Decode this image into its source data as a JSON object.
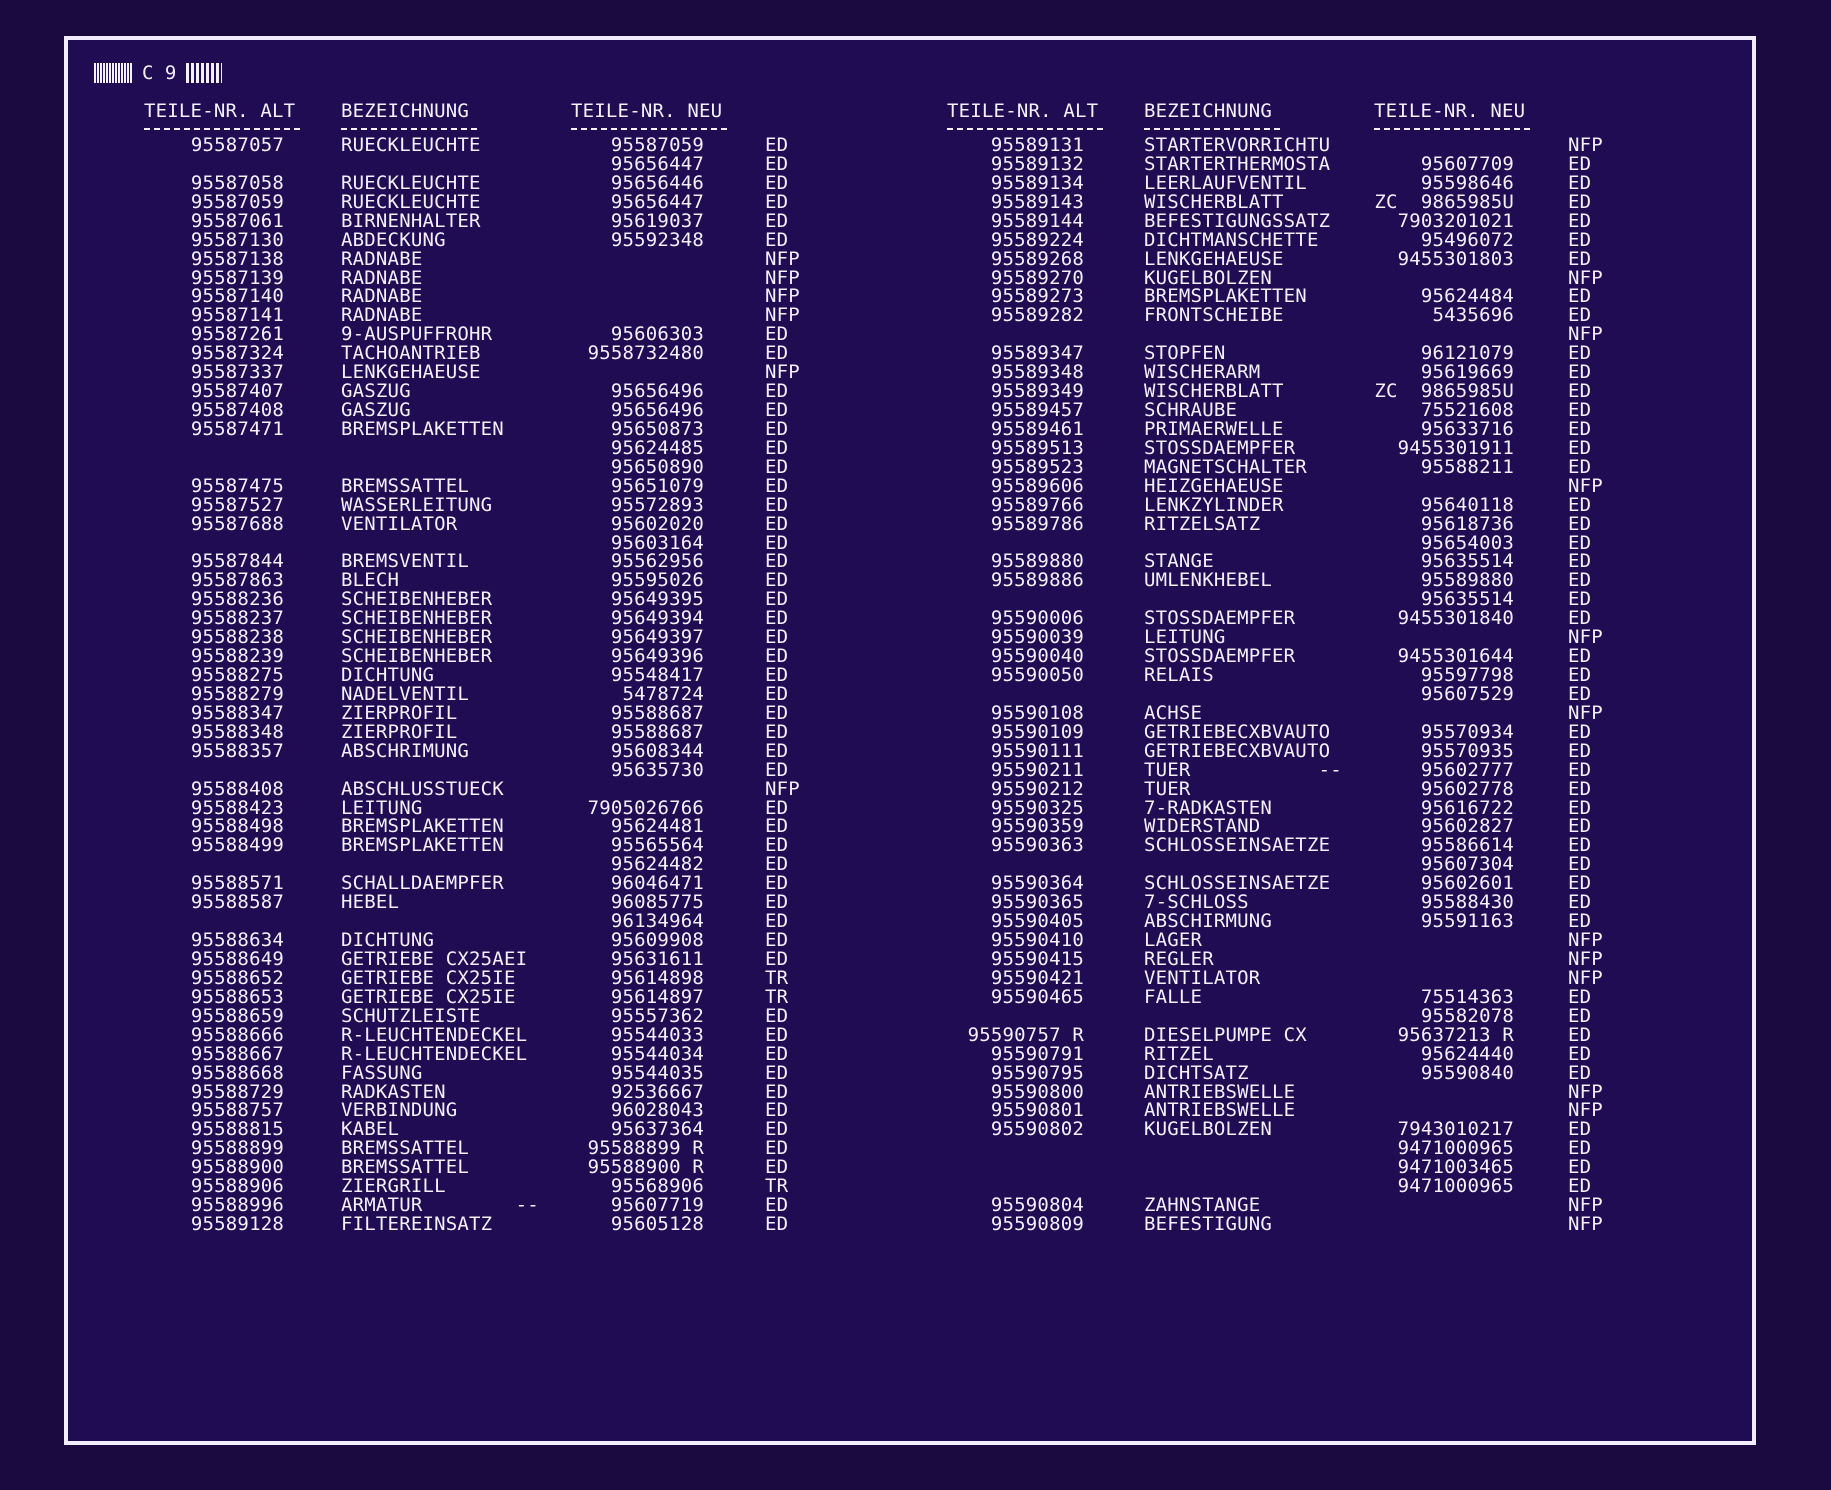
{
  "sheet": {
    "code": "C 9"
  },
  "headers": {
    "left": [
      "TEILE-NR. ALT",
      "BEZEICHNUNG",
      "TEILE-NR. NEU"
    ],
    "right": [
      "TEILE-NR. ALT",
      "BEZEICHNUNG",
      "TEILE-NR. NEU"
    ]
  },
  "rows": [
    {
      "l": [
        "95587057",
        "RUECKLEUCHTE",
        "95587059",
        "ED"
      ],
      "r": [
        "95589131",
        "STARTERVORRICHTU",
        "",
        "NFP"
      ]
    },
    {
      "l": [
        "",
        "",
        "95656447",
        "ED"
      ],
      "r": [
        "95589132",
        "STARTERTHERMOSTA",
        "95607709",
        "ED"
      ]
    },
    {
      "l": [
        "95587058",
        "RUECKLEUCHTE",
        "95656446",
        "ED"
      ],
      "r": [
        "95589134",
        "LEERLAUFVENTIL",
        "95598646",
        "ED"
      ]
    },
    {
      "l": [
        "95587059",
        "RUECKLEUCHTE",
        "95656447",
        "ED"
      ],
      "r": [
        "95589143",
        "WISCHERBLATT",
        "ZC  9865985U",
        "ED"
      ]
    },
    {
      "l": [
        "95587061",
        "BIRNENHALTER",
        "95619037",
        "ED"
      ],
      "r": [
        "95589144",
        "BEFESTIGUNGSSATZ",
        "7903201021",
        "ED"
      ]
    },
    {
      "l": [
        "95587130",
        "ABDECKUNG",
        "95592348",
        "ED"
      ],
      "r": [
        "95589224",
        "DICHTMANSCHETTE",
        "95496072",
        "ED"
      ]
    },
    {
      "l": [
        "95587138",
        "RADNABE",
        "",
        "NFP"
      ],
      "r": [
        "95589268",
        "LENKGEHAEUSE",
        "9455301803",
        "ED"
      ]
    },
    {
      "l": [
        "95587139",
        "RADNABE",
        "",
        "NFP"
      ],
      "r": [
        "95589270",
        "KUGELBOLZEN",
        "",
        "NFP"
      ]
    },
    {
      "l": [
        "95587140",
        "RADNABE",
        "",
        "NFP"
      ],
      "r": [
        "95589273",
        "BREMSPLAKETTEN",
        "95624484",
        "ED"
      ]
    },
    {
      "l": [
        "95587141",
        "RADNABE",
        "",
        "NFP"
      ],
      "r": [
        "95589282",
        "FRONTSCHEIBE",
        "5435696",
        "ED"
      ]
    },
    {
      "l": [
        "95587261",
        "9-AUSPUFFROHR",
        "95606303",
        "ED"
      ],
      "r": [
        "",
        "",
        "",
        "NFP"
      ]
    },
    {
      "l": [
        "95587324",
        "TACHOANTRIEB",
        "9558732480",
        "ED"
      ],
      "r": [
        "95589347",
        "STOPFEN",
        "96121079",
        "ED"
      ]
    },
    {
      "l": [
        "95587337",
        "LENKGEHAEUSE",
        "",
        "NFP"
      ],
      "r": [
        "95589348",
        "WISCHERARM",
        "95619669",
        "ED"
      ]
    },
    {
      "l": [
        "95587407",
        "GASZUG",
        "95656496",
        "ED"
      ],
      "r": [
        "95589349",
        "WISCHERBLATT",
        "ZC  9865985U",
        "ED"
      ]
    },
    {
      "l": [
        "95587408",
        "GASZUG",
        "95656496",
        "ED"
      ],
      "r": [
        "95589457",
        "SCHRAUBE",
        "75521608",
        "ED"
      ]
    },
    {
      "l": [
        "95587471",
        "BREMSPLAKETTEN",
        "95650873",
        "ED"
      ],
      "r": [
        "95589461",
        "PRIMAERWELLE",
        "95633716",
        "ED"
      ]
    },
    {
      "l": [
        "",
        "",
        "95624485",
        "ED"
      ],
      "r": [
        "95589513",
        "STOSSDAEMPFER",
        "9455301911",
        "ED"
      ]
    },
    {
      "l": [
        "",
        "",
        "95650890",
        "ED"
      ],
      "r": [
        "95589523",
        "MAGNETSCHALTER",
        "95588211",
        "ED"
      ]
    },
    {
      "l": [
        "95587475",
        "BREMSSATTEL",
        "95651079",
        "ED"
      ],
      "r": [
        "95589606",
        "HEIZGEHAEUSE",
        "",
        "NFP"
      ]
    },
    {
      "l": [
        "95587527",
        "WASSERLEITUNG",
        "95572893",
        "ED"
      ],
      "r": [
        "95589766",
        "LENKZYLINDER",
        "95640118",
        "ED"
      ]
    },
    {
      "l": [
        "95587688",
        "VENTILATOR",
        "95602020",
        "ED"
      ],
      "r": [
        "95589786",
        "RITZELSATZ",
        "95618736",
        "ED"
      ]
    },
    {
      "l": [
        "",
        "",
        "95603164",
        "ED"
      ],
      "r": [
        "",
        "",
        "95654003",
        "ED"
      ]
    },
    {
      "l": [
        "95587844",
        "BREMSVENTIL",
        "95562956",
        "ED"
      ],
      "r": [
        "95589880",
        "STANGE",
        "95635514",
        "ED"
      ]
    },
    {
      "l": [
        "95587863",
        "BLECH",
        "95595026",
        "ED"
      ],
      "r": [
        "95589886",
        "UMLENKHEBEL",
        "95589880",
        "ED"
      ]
    },
    {
      "l": [
        "95588236",
        "SCHEIBENHEBER",
        "95649395",
        "ED"
      ],
      "r": [
        "",
        "",
        "95635514",
        "ED"
      ]
    },
    {
      "l": [
        "95588237",
        "SCHEIBENHEBER",
        "95649394",
        "ED"
      ],
      "r": [
        "95590006",
        "STOSSDAEMPFER",
        "9455301840",
        "ED"
      ]
    },
    {
      "l": [
        "95588238",
        "SCHEIBENHEBER",
        "95649397",
        "ED"
      ],
      "r": [
        "95590039",
        "LEITUNG",
        "",
        "NFP"
      ]
    },
    {
      "l": [
        "95588239",
        "SCHEIBENHEBER",
        "95649396",
        "ED"
      ],
      "r": [
        "95590040",
        "STOSSDAEMPFER",
        "9455301644",
        "ED"
      ]
    },
    {
      "l": [
        "95588275",
        "DICHTUNG",
        "95548417",
        "ED"
      ],
      "r": [
        "95590050",
        "RELAIS",
        "95597798",
        "ED"
      ]
    },
    {
      "l": [
        "95588279",
        "NADELVENTIL",
        "5478724",
        "ED"
      ],
      "r": [
        "",
        "",
        "95607529",
        "ED"
      ]
    },
    {
      "l": [
        "95588347",
        "ZIERPROFIL",
        "95588687",
        "ED"
      ],
      "r": [
        "95590108",
        "ACHSE",
        "",
        "NFP"
      ]
    },
    {
      "l": [
        "95588348",
        "ZIERPROFIL",
        "95588687",
        "ED"
      ],
      "r": [
        "95590109",
        "GETRIEBECXBVAUTO",
        "95570934",
        "ED"
      ]
    },
    {
      "l": [
        "95588357",
        "ABSCHRIMUNG",
        "95608344",
        "ED"
      ],
      "r": [
        "95590111",
        "GETRIEBECXBVAUTO",
        "95570935",
        "ED"
      ]
    },
    {
      "l": [
        "",
        "",
        "95635730",
        "ED"
      ],
      "r": [
        "95590211",
        "TUER           --",
        "95602777",
        "ED"
      ]
    },
    {
      "l": [
        "95588408",
        "ABSCHLUSSTUECK",
        "",
        "NFP"
      ],
      "r": [
        "95590212",
        "TUER",
        "95602778",
        "ED"
      ]
    },
    {
      "l": [
        "95588423",
        "LEITUNG",
        "7905026766",
        "ED"
      ],
      "r": [
        "95590325",
        "7-RADKASTEN",
        "95616722",
        "ED"
      ]
    },
    {
      "l": [
        "95588498",
        "BREMSPLAKETTEN",
        "95624481",
        "ED"
      ],
      "r": [
        "95590359",
        "WIDERSTAND",
        "95602827",
        "ED"
      ]
    },
    {
      "l": [
        "95588499",
        "BREMSPLAKETTEN",
        "95565564",
        "ED"
      ],
      "r": [
        "95590363",
        "SCHLOSSEINSAETZE",
        "95586614",
        "ED"
      ]
    },
    {
      "l": [
        "",
        "",
        "95624482",
        "ED"
      ],
      "r": [
        "",
        "",
        "95607304",
        "ED"
      ]
    },
    {
      "l": [
        "95588571",
        "SCHALLDAEMPFER",
        "96046471",
        "ED"
      ],
      "r": [
        "95590364",
        "SCHLOSSEINSAETZE",
        "95602601",
        "ED"
      ]
    },
    {
      "l": [
        "95588587",
        "HEBEL",
        "96085775",
        "ED"
      ],
      "r": [
        "95590365",
        "7-SCHLOSS",
        "95588430",
        "ED"
      ]
    },
    {
      "l": [
        "",
        "",
        "96134964",
        "ED"
      ],
      "r": [
        "95590405",
        "ABSCHIRMUNG",
        "95591163",
        "ED"
      ]
    },
    {
      "l": [
        "95588634",
        "DICHTUNG",
        "95609908",
        "ED"
      ],
      "r": [
        "95590410",
        "LAGER",
        "",
        "NFP"
      ]
    },
    {
      "l": [
        "95588649",
        "GETRIEBE CX25AEI",
        "95631611",
        "ED"
      ],
      "r": [
        "95590415",
        "REGLER",
        "",
        "NFP"
      ]
    },
    {
      "l": [
        "95588652",
        "GETRIEBE CX25IE",
        "95614898",
        "TR"
      ],
      "r": [
        "95590421",
        "VENTILATOR",
        "",
        "NFP"
      ]
    },
    {
      "l": [
        "95588653",
        "GETRIEBE CX25IE",
        "95614897",
        "TR"
      ],
      "r": [
        "95590465",
        "FALLE",
        "75514363",
        "ED"
      ]
    },
    {
      "l": [
        "95588659",
        "SCHUTZLEISTE",
        "95557362",
        "ED"
      ],
      "r": [
        "",
        "",
        "95582078",
        "ED"
      ]
    },
    {
      "l": [
        "95588666",
        "R-LEUCHTENDECKEL",
        "95544033",
        "ED"
      ],
      "r": [
        "95590757 R",
        "DIESELPUMPE CX",
        "95637213 R",
        "ED"
      ]
    },
    {
      "l": [
        "95588667",
        "R-LEUCHTENDECKEL",
        "95544034",
        "ED"
      ],
      "r": [
        "95590791",
        "RITZEL",
        "95624440",
        "ED"
      ]
    },
    {
      "l": [
        "95588668",
        "FASSUNG",
        "95544035",
        "ED"
      ],
      "r": [
        "95590795",
        "DICHTSATZ",
        "95590840",
        "ED"
      ]
    },
    {
      "l": [
        "95588729",
        "RADKASTEN",
        "92536667",
        "ED"
      ],
      "r": [
        "95590800",
        "ANTRIEBSWELLE",
        "",
        "NFP"
      ]
    },
    {
      "l": [
        "95588757",
        "VERBINDUNG",
        "96028043",
        "ED"
      ],
      "r": [
        "95590801",
        "ANTRIEBSWELLE",
        "",
        "NFP"
      ]
    },
    {
      "l": [
        "95588815",
        "KABEL",
        "95637364",
        "ED"
      ],
      "r": [
        "95590802",
        "KUGELBOLZEN",
        "7943010217",
        "ED"
      ]
    },
    {
      "l": [
        "95588899",
        "BREMSSATTEL",
        "95588899 R",
        "ED"
      ],
      "r": [
        "",
        "",
        "9471000965",
        "ED"
      ]
    },
    {
      "l": [
        "95588900",
        "BREMSSATTEL",
        "95588900 R",
        "ED"
      ],
      "r": [
        "",
        "",
        "9471003465",
        "ED"
      ]
    },
    {
      "l": [
        "95588906",
        "ZIERGRILL",
        "95568906",
        "TR"
      ],
      "r": [
        "",
        "",
        "9471000965",
        "ED"
      ]
    },
    {
      "l": [
        "95588996",
        "ARMATUR        --",
        "95607719",
        "ED"
      ],
      "r": [
        "95590804",
        "ZAHNSTANGE",
        "",
        "NFP"
      ]
    },
    {
      "l": [
        "95589128",
        "FILTEREINSATZ",
        "95605128",
        "ED"
      ],
      "r": [
        "95590809",
        "BEFESTIGUNG",
        "",
        "NFP"
      ]
    }
  ]
}
